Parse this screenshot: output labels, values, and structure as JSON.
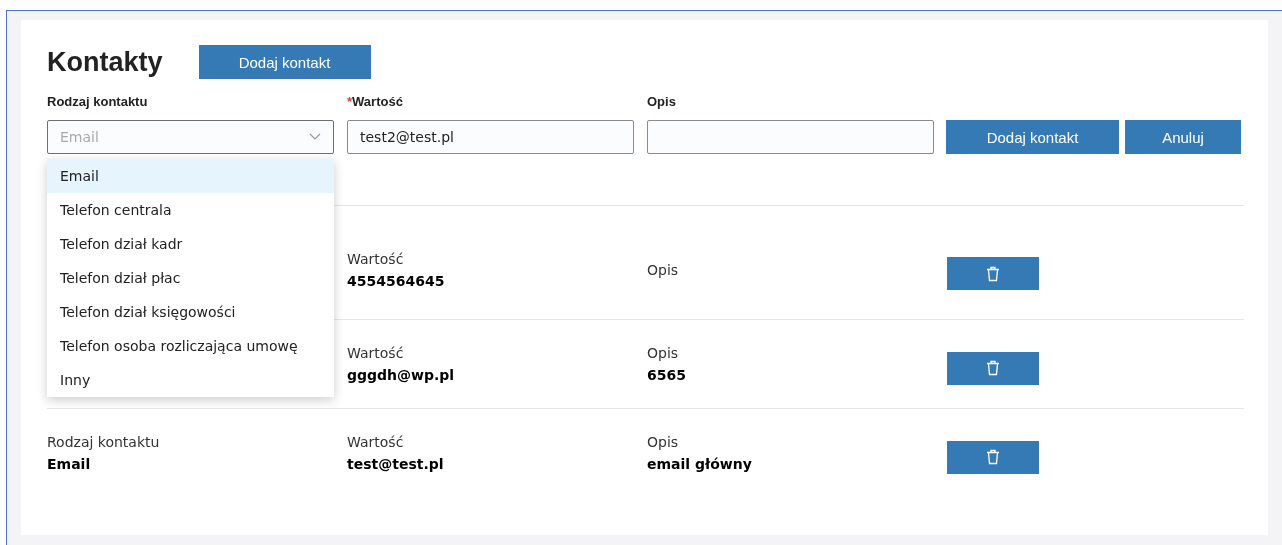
{
  "title": "Kontakty",
  "header_button": "Dodaj kontakt",
  "form": {
    "fields": [
      {
        "label": "Rodzaj kontaktu",
        "required": false,
        "kind": "select",
        "placeholder": "Email",
        "expanded": true
      },
      {
        "label": "Wartość",
        "required": true,
        "kind": "text",
        "value": "test2@test.pl"
      },
      {
        "label": "Opis",
        "required": false,
        "kind": "text"
      }
    ],
    "required_mark": "*",
    "buttons": [
      "Dodaj kontakt",
      "Anuluj"
    ],
    "dropdown_options": [
      {
        "label": "Email",
        "selected": true
      },
      {
        "label": "Telefon centrala",
        "selected": false
      },
      {
        "label": "Telefon dział kadr",
        "selected": false
      },
      {
        "label": "Telefon dział płac",
        "selected": false
      },
      {
        "label": "Telefon dział księgowości",
        "selected": false
      },
      {
        "label": "Telefon osoba rozliczająca umowę",
        "selected": false
      },
      {
        "label": "Inny",
        "selected": false
      }
    ]
  },
  "contacts": [
    {
      "value_label": "Wartość",
      "value": "4554564645",
      "description_label": "Opis"
    },
    {
      "value_label": "Wartość",
      "value": "gggdh@wp.pl",
      "description_label": "Opis",
      "description": "6565"
    },
    {
      "type_label": "Rodzaj kontaktu",
      "type": "Email",
      "value_label": "Wartość",
      "value": "test@test.pl",
      "description_label": "Opis",
      "description": "email główny"
    }
  ]
}
